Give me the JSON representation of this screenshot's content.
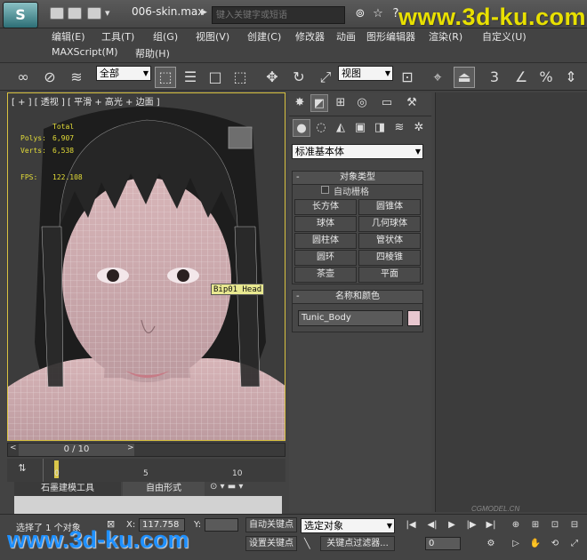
{
  "window": {
    "file_name": "006-skin.max",
    "search_placeholder": "键入关键字或短语"
  },
  "watermarks": {
    "top": "www.3d-ku.com",
    "bottom": "www.3d-ku.com",
    "cg": "CGMODEL.CN"
  },
  "menu": {
    "items": [
      "编辑(E)",
      "工具(T)",
      "组(G)",
      "视图(V)",
      "创建(C)",
      "修改器",
      "动画",
      "图形编辑器",
      "渲染(R)",
      "自定义(U)"
    ],
    "row2": [
      "MAXScript(M)",
      "帮助(H)"
    ]
  },
  "toolbar": {
    "selection_filter": "全部",
    "coord_system": "视图",
    "snap_label": "3"
  },
  "viewport": {
    "label": "[ + ] [ 透视 ] [ 平滑 + 高光 + 边面 ]",
    "stats": {
      "total_label": "Total",
      "polys_label": "Polys:",
      "polys_value": "6,907",
      "verts_label": "Verts:",
      "verts_value": "6,538",
      "fps_label": "FPS:",
      "fps_value": "122.108"
    },
    "selected_label": "Bip01 Head"
  },
  "timeline": {
    "slider_text": "0 / 10",
    "ticks": [
      "0",
      "5",
      "10"
    ]
  },
  "ribbon": {
    "tabs": [
      "石墨建模工具",
      "自由形式"
    ]
  },
  "command_panel": {
    "category": "标准基本体",
    "object_type_title": "对象类型",
    "autogrid_label": "自动栅格",
    "object_buttons": [
      "长方体",
      "圆锥体",
      "球体",
      "几何球体",
      "圆柱体",
      "管状体",
      "圆环",
      "四棱锥",
      "茶壶",
      "平面"
    ],
    "name_color_title": "名称和颜色",
    "object_name": "Tunic_Body",
    "object_color": "#e8c7cf"
  },
  "status": {
    "selection_text": "选择了 1 个对象",
    "x_label": "X:",
    "x_value": "117.758",
    "y_label": "Y:",
    "auto_key": "自动关键点",
    "set_key": "设置关键点",
    "selected_dropdown": "选定对象",
    "key_filters": "关键点过滤器...",
    "frame": "0"
  }
}
